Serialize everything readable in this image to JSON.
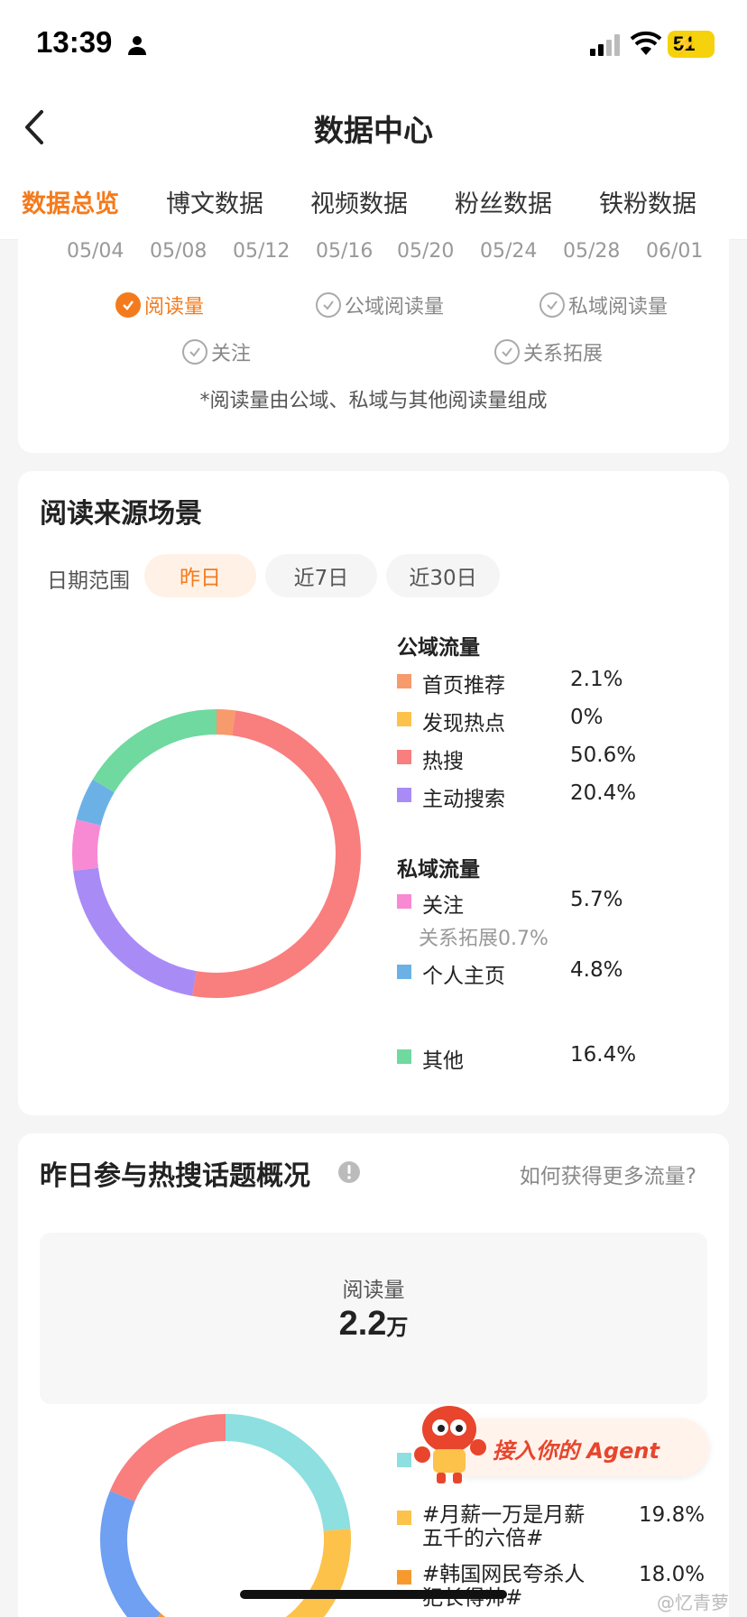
{
  "status": {
    "time": "13:39",
    "battery": "51"
  },
  "nav": {
    "title": "数据中心"
  },
  "tabs": [
    {
      "label": "数据总览",
      "active": true
    },
    {
      "label": "博文数据"
    },
    {
      "label": "视频数据"
    },
    {
      "label": "粉丝数据"
    },
    {
      "label": "铁粉数据"
    }
  ],
  "trend": {
    "x_labels": [
      "05/04",
      "05/08",
      "05/12",
      "05/16",
      "05/20",
      "05/24",
      "05/28",
      "06/01"
    ],
    "options": [
      {
        "label": "阅读量",
        "checked": true
      },
      {
        "label": "公域阅读量",
        "checked": false
      },
      {
        "label": "私域阅读量",
        "checked": false
      },
      {
        "label": "关注",
        "checked": false
      },
      {
        "label": "关系拓展",
        "checked": false
      }
    ],
    "note": "*阅读量由公域、私域与其他阅读量组成"
  },
  "source": {
    "title": "阅读来源场景",
    "range_label": "日期范围",
    "ranges": [
      "昨日",
      "近7日",
      "近30日"
    ],
    "active_range": "昨日",
    "public_title": "公域流量",
    "private_title": "私域流量",
    "private_sub_note": "关系拓展0.7%"
  },
  "chart_data": [
    {
      "type": "pie",
      "categories": [
        "首页推荐",
        "发现热点",
        "热搜",
        "主动搜索",
        "关注",
        "个人主页",
        "其他"
      ],
      "values": [
        2.1,
        0,
        50.6,
        20.4,
        5.7,
        4.8,
        16.4
      ],
      "labels": [
        "2.1%",
        "0%",
        "50.6%",
        "20.4%",
        "5.7%",
        "4.8%",
        "16.4%"
      ],
      "colors": [
        "#f79a6c",
        "#fcc24a",
        "#f97e7e",
        "#a98bf6",
        "#f88ad4",
        "#6cb1e6",
        "#6fd9a0"
      ],
      "groups": {
        "公域流量": [
          "首页推荐",
          "发现热点",
          "热搜",
          "主动搜索"
        ],
        "私域流量": [
          "关注",
          "个人主页"
        ]
      }
    },
    {
      "type": "pie",
      "categories": [
        "",
        "#月薪一万是月薪五千的六倍#",
        "#韩国网民夸杀人犯长得帅#"
      ],
      "values": [
        null,
        19.8,
        18.0
      ],
      "labels": [
        "",
        "19.8%",
        "18.0%"
      ],
      "colors": [
        "#8ddfe0",
        "#fcc24a",
        "#f79a2e"
      ]
    }
  ],
  "hot": {
    "title": "昨日参与热搜话题概况",
    "help_link": "如何获得更多流量?",
    "stat_label": "阅读量",
    "stat_value": "2.2",
    "stat_unit": "万"
  },
  "agent_banner": {
    "label": "接入你的 Agent"
  },
  "watermark": "@忆青萝"
}
